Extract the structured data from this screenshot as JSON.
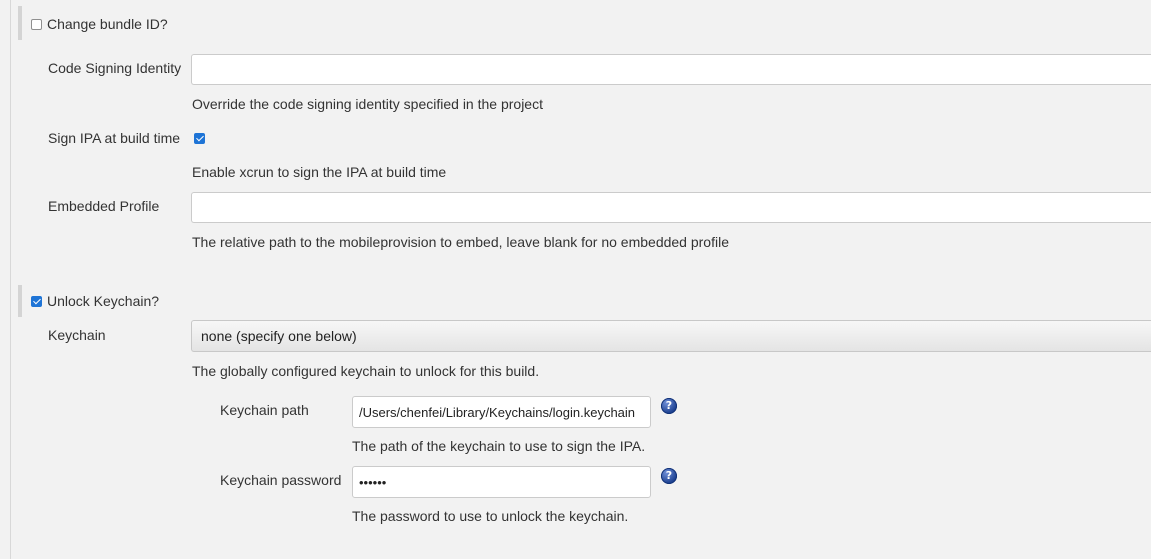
{
  "change_bundle_id": {
    "label": "Change bundle ID?",
    "checked": false
  },
  "code_signing_identity": {
    "label": "Code Signing Identity",
    "value": "",
    "description": "Override the code signing identity specified in the project"
  },
  "sign_ipa": {
    "label": "Sign IPA at build time",
    "checked": true,
    "description": "Enable xcrun to sign the IPA at build time"
  },
  "embedded_profile": {
    "label": "Embedded Profile",
    "value": "",
    "description": "The relative path to the mobileprovision to embed, leave blank for no embedded profile"
  },
  "unlock_keychain": {
    "label": "Unlock Keychain?",
    "checked": true
  },
  "keychain": {
    "label": "Keychain",
    "selected": "none (specify one below)",
    "description": "The globally configured keychain to unlock for this build."
  },
  "keychain_path": {
    "label": "Keychain path",
    "value": "/Users/chenfei/Library/Keychains/login.keychain",
    "description": "The path of the keychain to use to sign the IPA.",
    "help_glyph": "?"
  },
  "keychain_password": {
    "label": "Keychain password",
    "value": "••••••",
    "description": "The password to use to unlock the keychain.",
    "help_glyph": "?"
  },
  "icons": {
    "help": "help-icon"
  },
  "colors": {
    "background": "#f2f2f2",
    "checkbox_accent": "#1e74d6",
    "help_icon": "#1b3f8f"
  }
}
